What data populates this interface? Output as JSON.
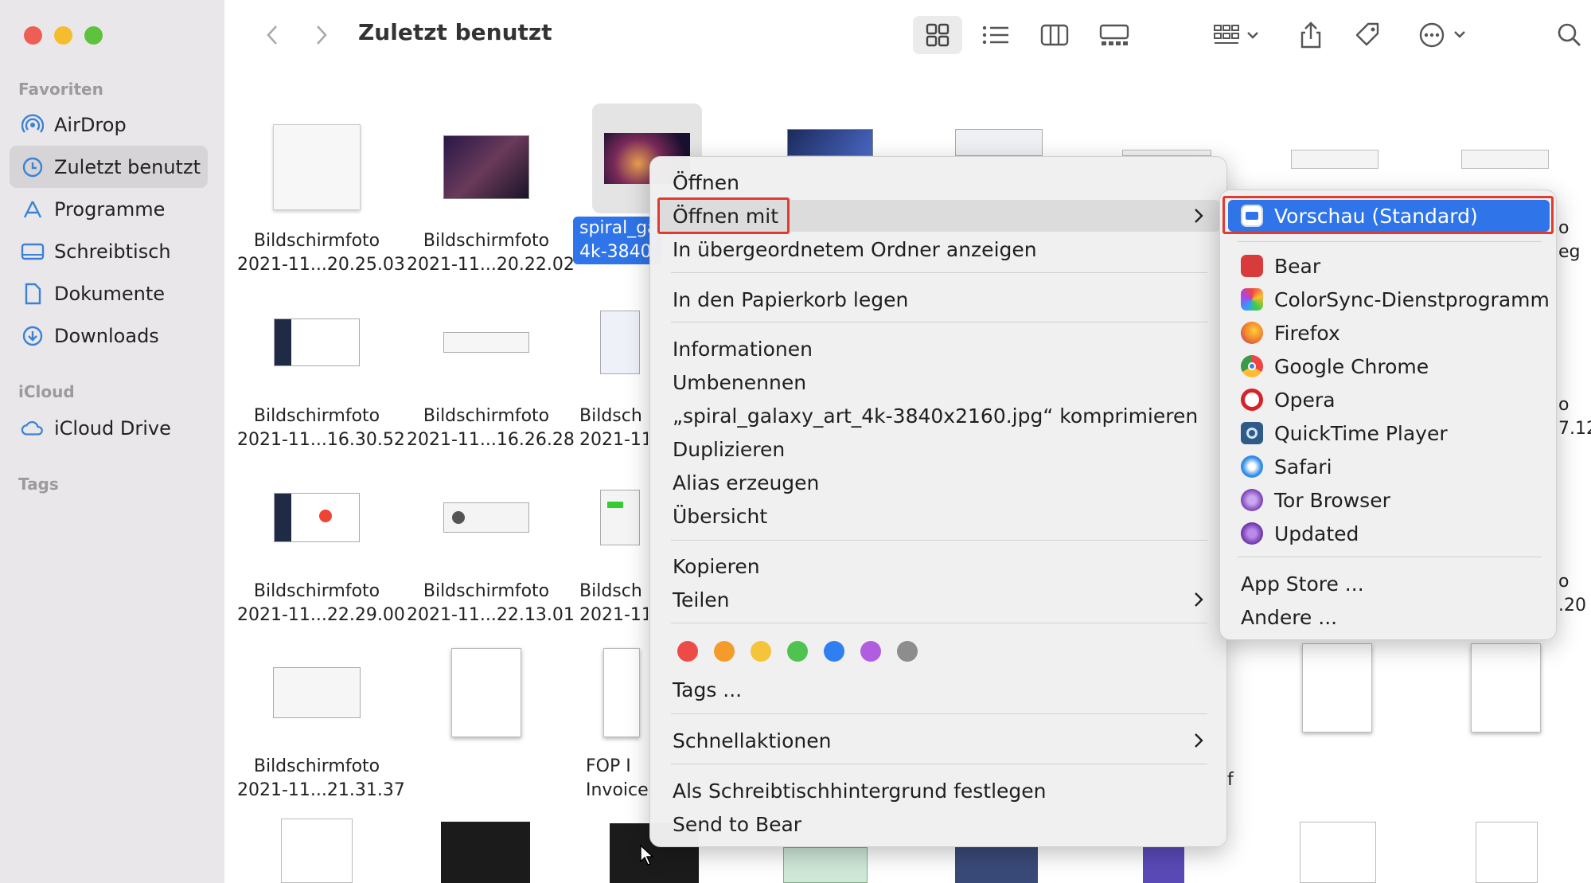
{
  "window": {
    "title": "Zuletzt benutzt"
  },
  "sidebar": {
    "favorites_label": "Favoriten",
    "items": [
      {
        "label": "AirDrop",
        "icon": "airdrop-icon"
      },
      {
        "label": "Zuletzt benutzt",
        "icon": "clock-icon",
        "selected": true
      },
      {
        "label": "Programme",
        "icon": "applications-icon"
      },
      {
        "label": "Schreibtisch",
        "icon": "desktop-icon"
      },
      {
        "label": "Dokumente",
        "icon": "document-icon"
      },
      {
        "label": "Downloads",
        "icon": "downloads-icon"
      }
    ],
    "icloud_label": "iCloud",
    "icloud_items": [
      {
        "label": "iCloud Drive",
        "icon": "cloud-icon"
      }
    ],
    "tags_label": "Tags"
  },
  "files": [
    {
      "name": "Bildschirmfoto",
      "sub": "2021-11...20.25.03"
    },
    {
      "name": "Bildschirmfoto",
      "sub": "2021-11...20.22.02"
    },
    {
      "name": "spiral_ga",
      "sub": "4k-3840"
    },
    {
      "name": "Bildschirmfoto",
      "sub": "2021-11...16.30.52"
    },
    {
      "name": "Bildschirmfoto",
      "sub": "2021-11...16.26.28"
    },
    {
      "name": "Bildsch",
      "sub": "2021-11."
    },
    {
      "name": "Bildschirmfoto",
      "sub": "2021-11...22.29.00"
    },
    {
      "name": "Bildschirmfoto",
      "sub": "2021-11...22.13.01"
    },
    {
      "name": "Bildsch",
      "sub": "2021-11."
    },
    {
      "name": "Bildschirmfoto",
      "sub": "2021-11...21.31.37"
    },
    {
      "name": "FOP I",
      "sub": "Invoice..."
    },
    {
      "name": "o",
      "sub": "eg"
    },
    {
      "name": "o",
      "sub": "7.12"
    },
    {
      "name": "o",
      "sub": ".20"
    },
    {
      "name": "",
      "sub": "f"
    }
  ],
  "context_menu": {
    "items": [
      "Öffnen",
      "Öffnen mit",
      "In übergeordnetem Ordner anzeigen",
      "In den Papierkorb legen",
      "Informationen",
      "Umbenennen",
      "„spiral_galaxy_art_4k-3840x2160.jpg“ komprimieren",
      "Duplizieren",
      "Alias erzeugen",
      "Übersicht",
      "Kopieren",
      "Teilen",
      "Tags ...",
      "Schnellaktionen",
      "Als Schreibtischhintergrund festlegen",
      "Send to Bear"
    ],
    "tag_colors": [
      "#ed4b47",
      "#f39c2b",
      "#f6c43b",
      "#4fc24f",
      "#2f7ff0",
      "#b15de0",
      "#8d8d8d"
    ]
  },
  "submenu": {
    "default_app": "Vorschau (Standard)",
    "apps": [
      {
        "name": "Bear",
        "color": "#d93a3a"
      },
      {
        "name": "ColorSync-Dienstprogramm",
        "color": "#7fb34a"
      },
      {
        "name": "Firefox",
        "color": "#f07a2a"
      },
      {
        "name": "Google Chrome",
        "color": "#3c9b4a"
      },
      {
        "name": "Opera",
        "color": "#d6232a"
      },
      {
        "name": "QuickTime Player",
        "color": "#2e5b87"
      },
      {
        "name": "Safari",
        "color": "#2f8be8"
      },
      {
        "name": "Tor Browser",
        "color": "#7b3fb5"
      },
      {
        "name": "Updated",
        "color": "#6a2fa8"
      }
    ],
    "extra": [
      "App Store ...",
      "Andere ..."
    ]
  }
}
